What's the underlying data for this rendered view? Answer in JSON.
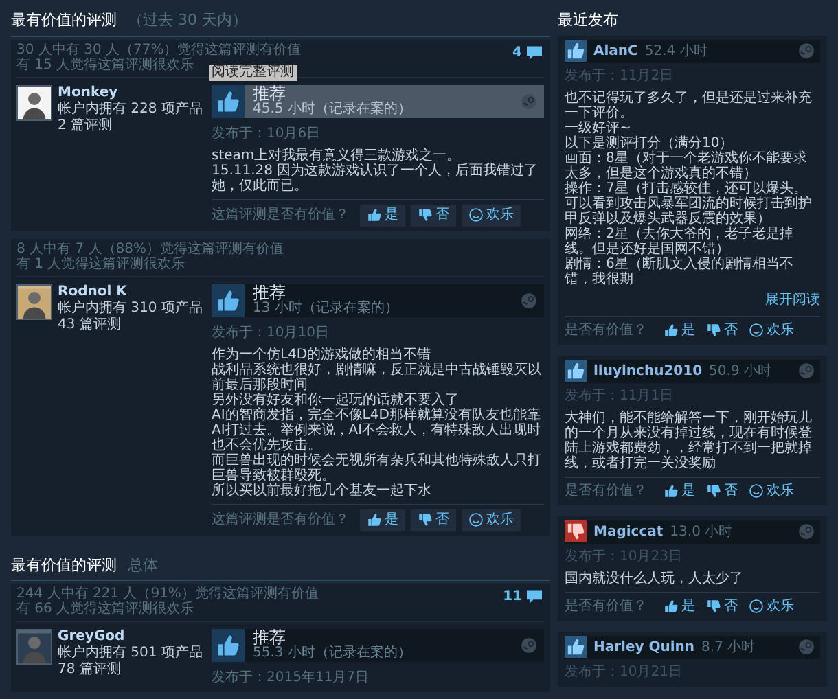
{
  "most_helpful_sections": [
    {
      "title": "最有价值的评测",
      "subtitle": "（过去 30 天内）",
      "reviews": [
        {
          "helpful": "30 人中有 30 人（77%）觉得这篇评测有价值",
          "funny": "有 15 人觉得这篇评测很欢乐",
          "comment_count": "4",
          "tooltip": "阅读完整评测",
          "highlighted": true,
          "author": {
            "name": "Monkey",
            "products": "帐户内拥有 228 项产品",
            "reviews": "2 篇评测"
          },
          "recommendation": {
            "kind": "up",
            "label": "推荐",
            "hours": "45.5 小时（记录在案的）"
          },
          "posted": "发布于：10月6日",
          "body": [
            "steam上对我最有意义得三款游戏之一。",
            "15.11.28 因为这款游戏认识了一个人，后面我错过了她，仅此而已。"
          ],
          "vote": {
            "question": "这篇评测是否有价值？",
            "yes": "是",
            "no": "否",
            "funny": "欢乐"
          }
        },
        {
          "helpful": "8 人中有 7 人（88%）觉得这篇评测有价值",
          "funny": "有 1 人觉得这篇评测很欢乐",
          "highlighted": false,
          "author": {
            "name": "Rodnol K",
            "products": "帐户内拥有 310 项产品",
            "reviews": "43 篇评测"
          },
          "recommendation": {
            "kind": "up",
            "label": "推荐",
            "hours": "13 小时（记录在案的）"
          },
          "posted": "发布于：10月10日",
          "body": [
            "作为一个仿L4D的游戏做的相当不错",
            "战利品系统也很好，剧情嘛，反正就是中古战锤毁灭以前最后那段时间",
            "另外没有好友和你一起玩的话就不要入了",
            "AI的智商发指，完全不像L4D那样就算没有队友也能靠AI打过去。举例来说，AI不会救人，有特殊敌人出现时也不会优先攻击。",
            "而巨兽出现的时候会无视所有杂兵和其他特殊敌人只打巨兽导致被群殴死。",
            "所以买以前最好拖几个基友一起下水"
          ],
          "vote": {
            "question": "这篇评测是否有价值？",
            "yes": "是",
            "no": "否",
            "funny": "欢乐"
          }
        }
      ]
    },
    {
      "title": "最有价值的评测",
      "subtitle": "总体",
      "reviews": [
        {
          "helpful": "244 人中有 221 人（91%）觉得这篇评测有价值",
          "funny": "有 66 人觉得这篇评测很欢乐",
          "comment_count": "11",
          "highlighted": false,
          "author": {
            "name": "GreyGod",
            "products": "帐户内拥有 501 项产品",
            "reviews": "78 篇评测"
          },
          "recommendation": {
            "kind": "up",
            "label": "推荐",
            "hours": "55.3 小时（记录在案的）"
          },
          "posted": "发布于：2015年11月7日"
        }
      ]
    }
  ],
  "recent": {
    "title": "最近发布",
    "reviews": [
      {
        "kind": "up",
        "author": "AlanC",
        "hours": "52.4 小时",
        "posted": "发布于：11月2日",
        "body": [
          "也不记得玩了多久了，但是还是过来补充一下评价。",
          "一级好评~",
          "以下是测评打分（满分10）",
          "画面：8星（对于一个老游戏你不能要求太多，但是这个游戏真的不错）",
          "操作：7星（打击感较佳，还可以爆头。可以看到攻击风暴军团流的时候打击到护甲反弹以及爆头武器反震的效果）",
          "网络：2星（去你大爷的，老子老是掉线。但是还好是国网不错）",
          "剧情：6星（断肌文入侵的剧情相当不错，我很期"
        ],
        "expand": "展开阅读",
        "vote": {
          "question": "是否有价值？",
          "yes": "是",
          "no": "否",
          "funny": "欢乐"
        }
      },
      {
        "kind": "up",
        "author": "liuyinchu2010",
        "hours": "50.9 小时",
        "posted": "发布于：11月1日",
        "body": [
          "大神们，能不能给解答一下，刚开始玩儿的一个月从来没有掉过线，现在有时候登陆上游戏都费劲，，经常打不到一把就掉线，或者打完一关没奖励"
        ],
        "vote": {
          "question": "是否有价值？",
          "yes": "是",
          "no": "否",
          "funny": "欢乐"
        }
      },
      {
        "kind": "down",
        "author": "Magiccat",
        "hours": "13.0 小时",
        "posted": "发布于：10月23日",
        "body": [
          "国内就没什么人玩，人太少了"
        ],
        "vote": {
          "question": "是否有价值？",
          "yes": "是",
          "no": "否",
          "funny": "欢乐"
        }
      },
      {
        "kind": "up",
        "author": "Harley Quinn",
        "hours": "8.7 小时",
        "posted": "发布于：10月21日"
      }
    ]
  }
}
